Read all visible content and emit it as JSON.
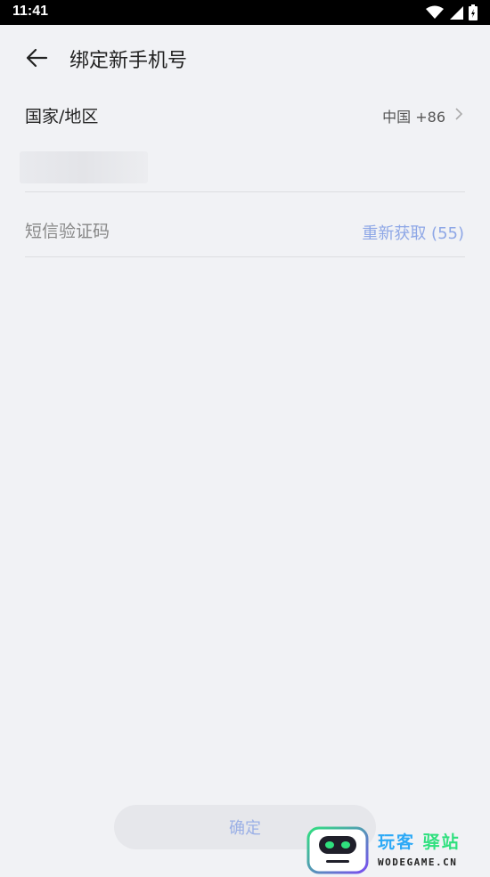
{
  "status": {
    "time": "11:41"
  },
  "header": {
    "title": "绑定新手机号"
  },
  "country": {
    "label": "国家/地区",
    "value": "中国 +86"
  },
  "sms": {
    "placeholder": "短信验证码",
    "resend": "重新获取 (55)"
  },
  "confirm": {
    "label": "确定"
  },
  "watermark": {
    "name_part1": "玩客",
    "name_part2": "驿站",
    "domain": "WODEGAME.CN"
  },
  "colors": {
    "accent_light": "#8ea7e6",
    "background": "#f1f2f5"
  }
}
